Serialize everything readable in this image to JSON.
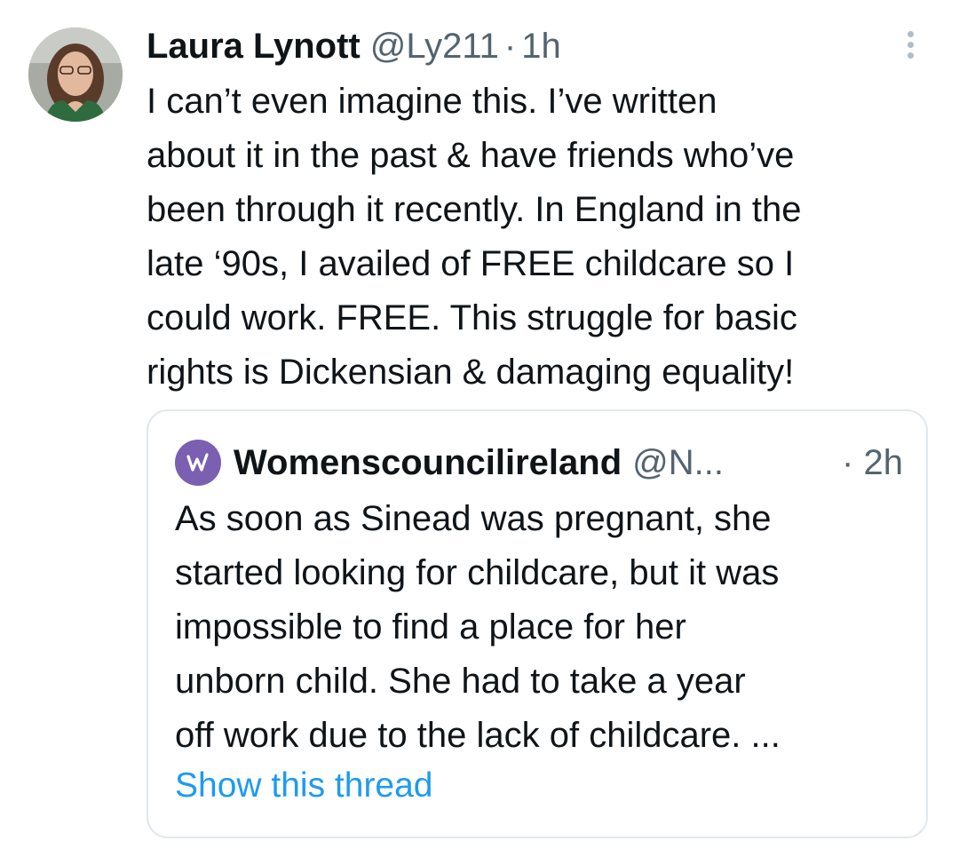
{
  "tweet": {
    "author_name": "Laura Lynott",
    "author_handle": "@Ly211",
    "separator": "·",
    "timestamp": "1h",
    "avatar_icon": "profile-photo",
    "more_icon": "more-options-icon",
    "text": "I can’t even imagine this. I’ve written\nabout it in the past & have friends who’ve\nbeen through it recently. In England in the\nlate ‘90s, I availed of FREE childcare so I\ncould work. FREE. This struggle for basic\nrights is Dickensian & damaging equality!"
  },
  "quoted_tweet": {
    "logo_icon": "womens-council-logo",
    "logo_letter": "W",
    "logo_color": "#7b5fb1",
    "author_name": "Womenscouncilireland",
    "author_handle": "@N...",
    "time_prefix": "·",
    "timestamp": "2h",
    "text": "As soon as Sinead was pregnant, she\nstarted looking for childcare, but it was\nimpossible to find a place for her\nunborn child. She had to take a year\noff work due to the lack of childcare. ...",
    "show_thread_label": "Show this thread",
    "link_color": "#1d9bf0"
  }
}
